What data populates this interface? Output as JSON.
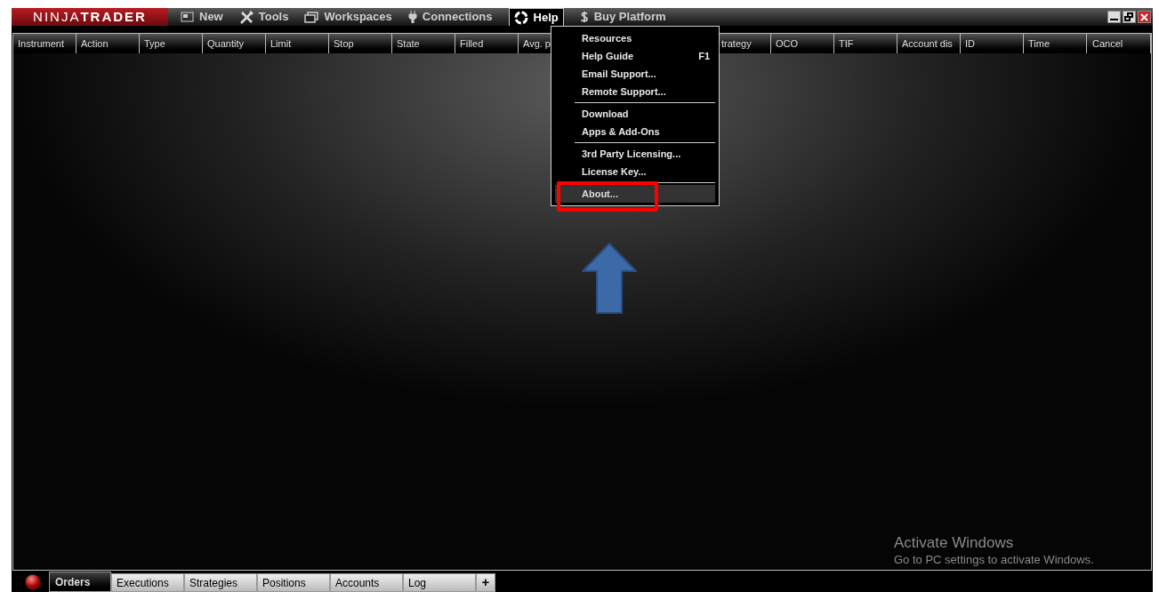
{
  "logo": {
    "light": "NINJA",
    "bold": "TRADER"
  },
  "menu_bar": [
    {
      "label": "New",
      "open": false
    },
    {
      "label": "Tools",
      "open": false
    },
    {
      "label": "Workspaces",
      "open": false
    },
    {
      "label": "Connections",
      "open": false
    },
    {
      "label": "Help",
      "open": true
    },
    {
      "label": "Buy Platform",
      "open": false
    }
  ],
  "columns": [
    "Instrument",
    "Action",
    "Type",
    "Quantity",
    "Limit",
    "Stop",
    "State",
    "Filled",
    "Avg. p",
    "",
    "",
    "trategy",
    "OCO",
    "TIF",
    "Account dis",
    "ID",
    "Time",
    "Cancel"
  ],
  "help_menu": [
    {
      "kind": "item",
      "label": "Resources",
      "highlighted": false
    },
    {
      "kind": "item",
      "label": "Help Guide",
      "shortcut": "F1",
      "highlighted": false
    },
    {
      "kind": "item",
      "label": "Email Support...",
      "highlighted": false
    },
    {
      "kind": "item",
      "label": "Remote Support...",
      "highlighted": false
    },
    {
      "kind": "separator"
    },
    {
      "kind": "item",
      "label": "Download",
      "highlighted": false
    },
    {
      "kind": "item",
      "label": "Apps & Add-Ons",
      "highlighted": false
    },
    {
      "kind": "separator"
    },
    {
      "kind": "item",
      "label": "3rd Party Licensing...",
      "highlighted": false
    },
    {
      "kind": "item",
      "label": "License Key...",
      "highlighted": false
    },
    {
      "kind": "separator"
    },
    {
      "kind": "item",
      "label": "About...",
      "highlighted": true
    }
  ],
  "tabs": [
    {
      "label": "Orders",
      "selected": true
    },
    {
      "label": "Executions",
      "selected": false
    },
    {
      "label": "Strategies",
      "selected": false
    },
    {
      "label": "Positions",
      "selected": false
    },
    {
      "label": "Accounts",
      "selected": false
    },
    {
      "label": "Log",
      "selected": false
    }
  ],
  "add_tab": "+",
  "activation_notice": {
    "title": "Activate Windows",
    "text": "Go to PC settings to activate Windows."
  }
}
